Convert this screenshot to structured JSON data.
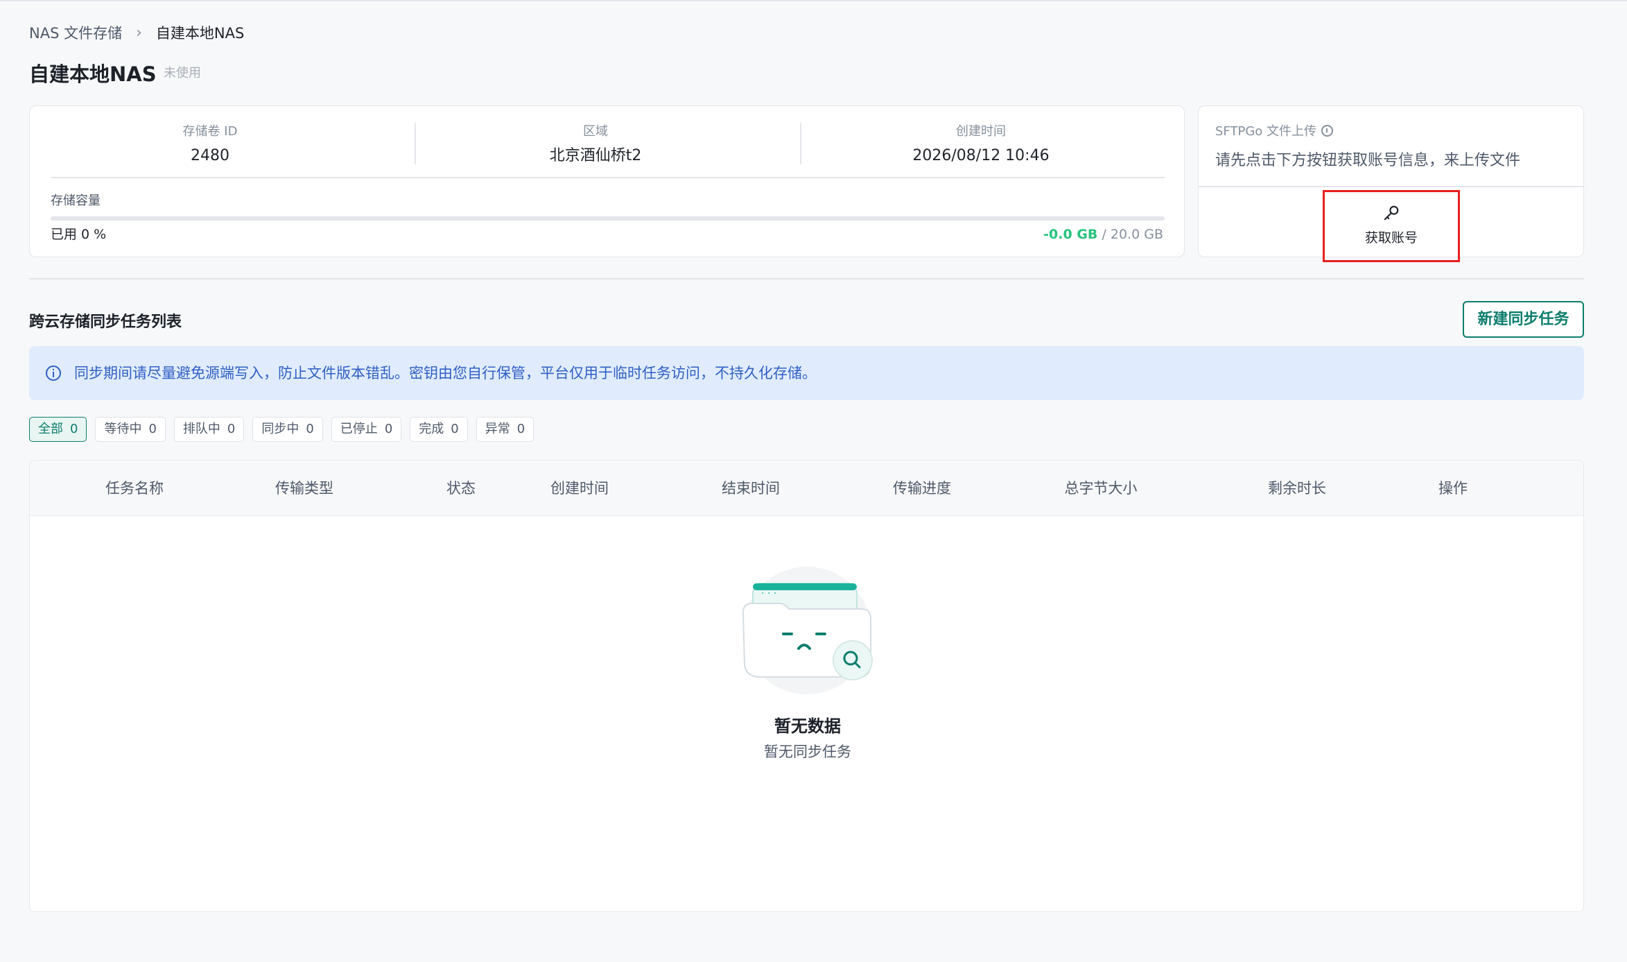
{
  "breadcrumb": {
    "parent": "NAS 文件存储",
    "separator": "›",
    "current": "自建本地NAS"
  },
  "page": {
    "title": "自建本地NAS",
    "status": "未使用"
  },
  "info": {
    "volume_id_label": "存储卷 ID",
    "volume_id": "2480",
    "region_label": "区域",
    "region": "北京酒仙桥t2",
    "created_label": "创建时间",
    "created": "2026/08/12 10:46",
    "capacity_label": "存储容量",
    "used_text": "已用 0 %",
    "used_size": "-0.0 GB",
    "size_separator": " / ",
    "total_size": "20.0 GB",
    "used_fraction": 0
  },
  "sftp": {
    "title": "SFTPGo 文件上传",
    "description": "请先点击下方按钮获取账号信息，来上传文件",
    "get_account_label": "获取账号",
    "icon": "key-icon"
  },
  "sync": {
    "section_title": "跨云存储同步任务列表",
    "new_task_label": "新建同步任务",
    "notice": "同步期间请尽量避免源端写入，防止文件版本错乱。密钥由您自行保管，平台仅用于临时任务访问，不持久化存储。",
    "filters": [
      {
        "label": "全部",
        "count": "0"
      },
      {
        "label": "等待中",
        "count": "0"
      },
      {
        "label": "排队中",
        "count": "0"
      },
      {
        "label": "同步中",
        "count": "0"
      },
      {
        "label": "已停止",
        "count": "0"
      },
      {
        "label": "完成",
        "count": "0"
      },
      {
        "label": "异常",
        "count": "0"
      }
    ],
    "columns": [
      "任务名称",
      "传输类型",
      "状态",
      "创建时间",
      "结束时间",
      "传输进度",
      "总字节大小",
      "剩余时长",
      "操作"
    ],
    "empty_title": "暂无数据",
    "empty_desc": "暂无同步任务"
  },
  "colors": {
    "accent": "#0c7d6b",
    "success": "#27c27c",
    "notice_bg": "#e0ecfd",
    "notice_text": "#2f5ec4",
    "highlight": "#e81f1f"
  }
}
